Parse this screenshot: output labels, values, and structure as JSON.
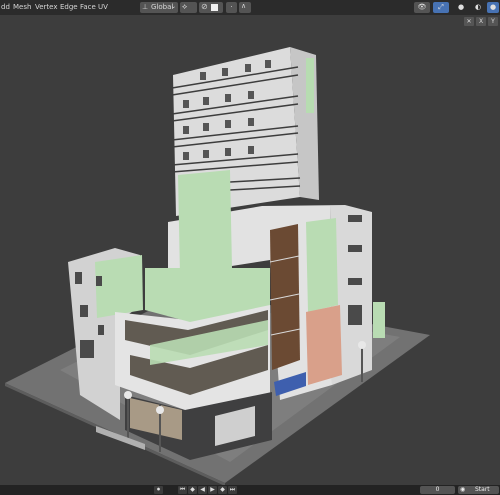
{
  "header": {
    "menus": [
      "dd",
      "Mesh",
      "Vertex",
      "Edge",
      "Face",
      "UV"
    ],
    "transform_orientation": "Global",
    "orientation_icon": "axis-icon",
    "pivot_icon": "pivot-icon",
    "snap_icon": "magnet-icon",
    "proportional_icon": "proportional-icon",
    "right_icons": [
      "overlay-icon",
      "gizmo-icon",
      "viewport-shading-icon",
      "solid-shading-icon"
    ]
  },
  "viewport": {
    "gizmo_labels": [
      "X",
      "Y"
    ],
    "background": "#3d3d3d"
  },
  "timeline": {
    "current_frame": "0",
    "start_label": "Start",
    "playback_icons": [
      "jump-start-icon",
      "prev-keyframe-icon",
      "play-reverse-icon",
      "play-icon",
      "next-keyframe-icon",
      "jump-end-icon"
    ],
    "marker_icon": "marker-icon"
  },
  "colors": {
    "header_bg": "#2b2b2b",
    "facade": "#e6e6e6",
    "glass_green": "#b9dcb3",
    "awning_blue": "#3e5fae",
    "ground": "#707070"
  }
}
